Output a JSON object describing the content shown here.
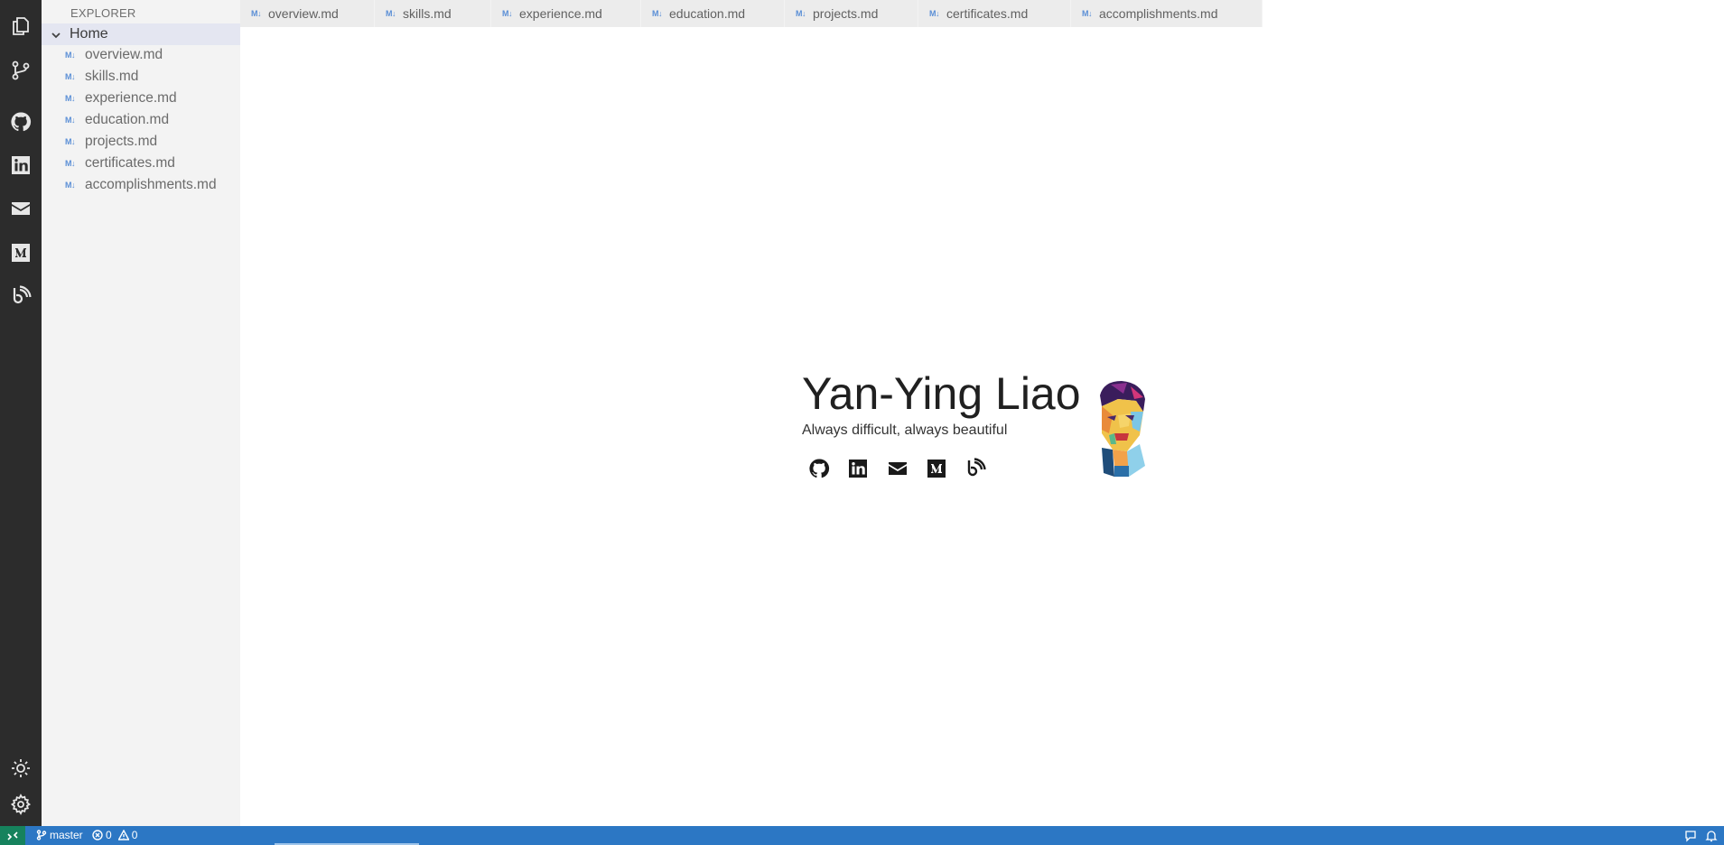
{
  "sidebar": {
    "title": "EXPLORER",
    "folder": "Home",
    "files": [
      {
        "label": "overview.md",
        "icon": "M↓"
      },
      {
        "label": "skills.md",
        "icon": "M↓"
      },
      {
        "label": "experience.md",
        "icon": "M↓"
      },
      {
        "label": "education.md",
        "icon": "M↓"
      },
      {
        "label": "projects.md",
        "icon": "M↓"
      },
      {
        "label": "certificates.md",
        "icon": "M↓"
      },
      {
        "label": "accomplishments.md",
        "icon": "M↓"
      }
    ]
  },
  "tabs": [
    {
      "label": "overview.md",
      "icon": "M↓"
    },
    {
      "label": "skills.md",
      "icon": "M↓"
    },
    {
      "label": "experience.md",
      "icon": "M↓"
    },
    {
      "label": "education.md",
      "icon": "M↓"
    },
    {
      "label": "projects.md",
      "icon": "M↓"
    },
    {
      "label": "certificates.md",
      "icon": "M↓"
    },
    {
      "label": "accomplishments.md",
      "icon": "M↓"
    }
  ],
  "main": {
    "name": "Yan-Ying Liao",
    "tagline": "Always difficult, always beautiful",
    "social": [
      "github-icon",
      "linkedin-icon",
      "mail-icon",
      "medium-icon",
      "blog-icon"
    ]
  },
  "activity_bar": [
    "explorer-icon",
    "source-control-icon",
    "github-icon",
    "linkedin-icon",
    "mail-icon",
    "medium-icon",
    "blog-icon",
    "theme-icon",
    "settings-icon"
  ],
  "status": {
    "branch": "master",
    "errors": "0",
    "warnings": "0"
  },
  "colors": {
    "activity_bar": "#2c2c2c",
    "sidebar": "#f3f3f3",
    "status_bar": "#2c77c4",
    "remote": "#16825d"
  }
}
